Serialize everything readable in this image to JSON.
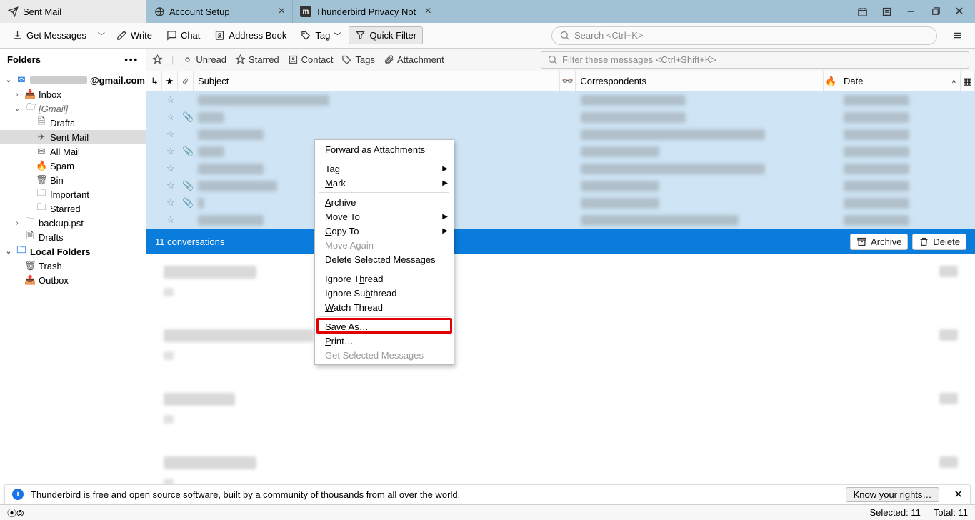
{
  "tabs": [
    {
      "label": "Sent Mail",
      "icon": "send"
    },
    {
      "label": "Account Setup",
      "icon": "globe"
    },
    {
      "label": "Thunderbird Privacy Notice",
      "icon": "m-logo"
    }
  ],
  "toolbar": {
    "get": "Get Messages",
    "write": "Write",
    "chat": "Chat",
    "addr": "Address Book",
    "tag": "Tag",
    "qf": "Quick Filter",
    "search_ph": "Search <Ctrl+K>"
  },
  "folders": {
    "header": "Folders",
    "account": "@gmail.com",
    "items": [
      "Inbox",
      "[Gmail]",
      "Drafts",
      "Sent Mail",
      "All Mail",
      "Spam",
      "Bin",
      "Important",
      "Starred",
      "backup.pst",
      "Drafts",
      "Local Folders",
      "Trash",
      "Outbox"
    ]
  },
  "filter": {
    "unread": "Unread",
    "starred": "Starred",
    "contact": "Contact",
    "tags": "Tags",
    "attachment": "Attachment",
    "ph": "Filter these messages <Ctrl+Shift+K>"
  },
  "columns": {
    "subject": "Subject",
    "correspondents": "Correspondents",
    "date": "Date"
  },
  "conv": {
    "title": "11 conversations",
    "archive": "Archive",
    "delete": "Delete"
  },
  "context": {
    "forward": "Forward as Attachments",
    "tag": "Tag",
    "mark": "Mark",
    "archive": "Archive",
    "moveto": "Move To",
    "copyto": "Copy To",
    "moveagain": "Move Again",
    "delete": "Delete Selected Messages",
    "igthread": "Ignore Thread",
    "igsub": "Ignore Subthread",
    "watch": "Watch Thread",
    "saveas": "Save As…",
    "print": "Print…",
    "getsel": "Get Selected Messages"
  },
  "notif": {
    "text": "Thunderbird is free and open source software, built by a community of thousands from all over the world.",
    "btn": "Know your rights…"
  },
  "status": {
    "selected": "Selected: 11",
    "total": "Total: 11"
  }
}
